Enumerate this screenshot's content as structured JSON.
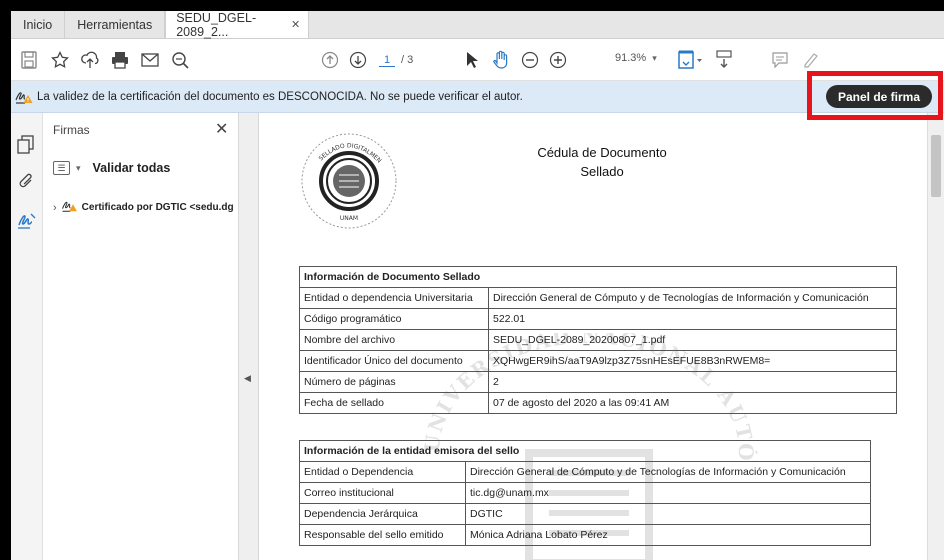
{
  "tabs": [
    {
      "label": "Inicio"
    },
    {
      "label": "Herramientas"
    },
    {
      "label": "SEDU_DGEL-2089_2..."
    }
  ],
  "toolbar": {
    "page_current": "1",
    "page_total": "/ 3",
    "zoom": "91.3%",
    "icons": [
      "save-icon",
      "star-icon",
      "upload-icon",
      "print-icon",
      "email-icon",
      "zoom-search-icon",
      "page-up-icon",
      "page-down-icon",
      "select-cursor-icon",
      "hand-tool-icon",
      "zoom-out-icon",
      "zoom-in-icon",
      "fit-page-icon",
      "scroll-mode-icon",
      "comment-icon",
      "highlight-icon",
      "sign-icon",
      "stamp-icon"
    ]
  },
  "warning": {
    "text": "La validez de la certificación del documento es DESCONOCIDA. No se puede verificar el autor.",
    "button": "Panel de firma"
  },
  "signatures_panel": {
    "title": "Firmas",
    "validate_all": "Validar todas",
    "certificate": "Certificado por DGTIC <sedu.dg"
  },
  "document": {
    "title_line1": "Cédula de Documento",
    "title_line2": "Sellado",
    "seal_text_top": "SELLADO DIGITALMENTE",
    "seal_text_bottom": "UNAM",
    "watermark_text": "UNIVERSIDAD NACIONAL AUTÓNOMA DE MÉXICO",
    "table1": {
      "header": "Información de Documento Sellado",
      "rows": [
        {
          "k": "Entidad o dependencia Universitaria",
          "v": "Dirección General de Cómputo y de Tecnologías de Información y Comunicación"
        },
        {
          "k": "Código programático",
          "v": "522.01"
        },
        {
          "k": "Nombre del archivo",
          "v": "SEDU_DGEL-2089_20200807_1.pdf"
        },
        {
          "k": "Identificador Único del documento",
          "v": "XQHwgER9ihS/aaT9A9lzp3Z75snHEsEFUE8B3nRWEM8="
        },
        {
          "k": "Número de páginas",
          "v": "2"
        },
        {
          "k": "Fecha de sellado",
          "v": "07 de agosto del 2020 a las 09:41 AM"
        }
      ]
    },
    "table2": {
      "header": "Información de la entidad emisora del sello",
      "rows": [
        {
          "k": "Entidad o Dependencia",
          "v": "Dirección General de Cómputo y de Tecnologías de Información y Comunicación"
        },
        {
          "k": "Correo institucional",
          "v": "tic.dg@unam.mx"
        },
        {
          "k": "Dependencia Jerárquica",
          "v": "DGTIC"
        },
        {
          "k": "Responsable del sello emitido",
          "v": "Mónica Adriana Lobato Pérez"
        }
      ]
    }
  },
  "colors": {
    "warning_bg": "#dce9f6",
    "highlight_box": "#e8141b",
    "panel_button_bg": "#2b2b2b",
    "accent": "#2a78c7"
  }
}
